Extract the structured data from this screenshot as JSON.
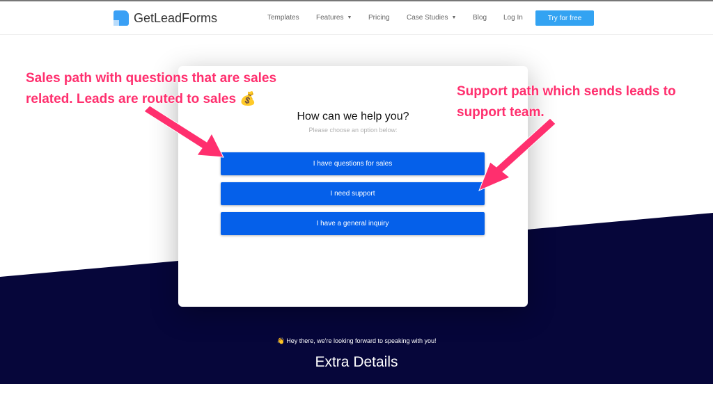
{
  "nav": {
    "brand": "GetLeadForms",
    "items": [
      {
        "label": "Templates"
      },
      {
        "label": "Features",
        "dropdown": true
      },
      {
        "label": "Pricing"
      },
      {
        "label": "Case Studies",
        "dropdown": true
      },
      {
        "label": "Blog"
      },
      {
        "label": "Log In"
      }
    ],
    "cta": "Try for free"
  },
  "form": {
    "title": "How can we help you?",
    "subtitle": "Please choose an option below:",
    "options": [
      "I have questions for sales",
      "I need support",
      "I have a general inquiry"
    ]
  },
  "footer": {
    "greeting_emoji": "👋",
    "greeting": "Hey there, we're looking forward to speaking with you!",
    "heading": "Extra Details"
  },
  "annotations": {
    "sales": "Sales path with questions that are sales related. Leads are routed to sales",
    "sales_emoji": "💰",
    "support": "Support path which sends leads to support team."
  },
  "colors": {
    "navy": "#06063a",
    "button": "#0560ea",
    "cta": "#33a3f2",
    "annotation": "#ff2f6e"
  }
}
